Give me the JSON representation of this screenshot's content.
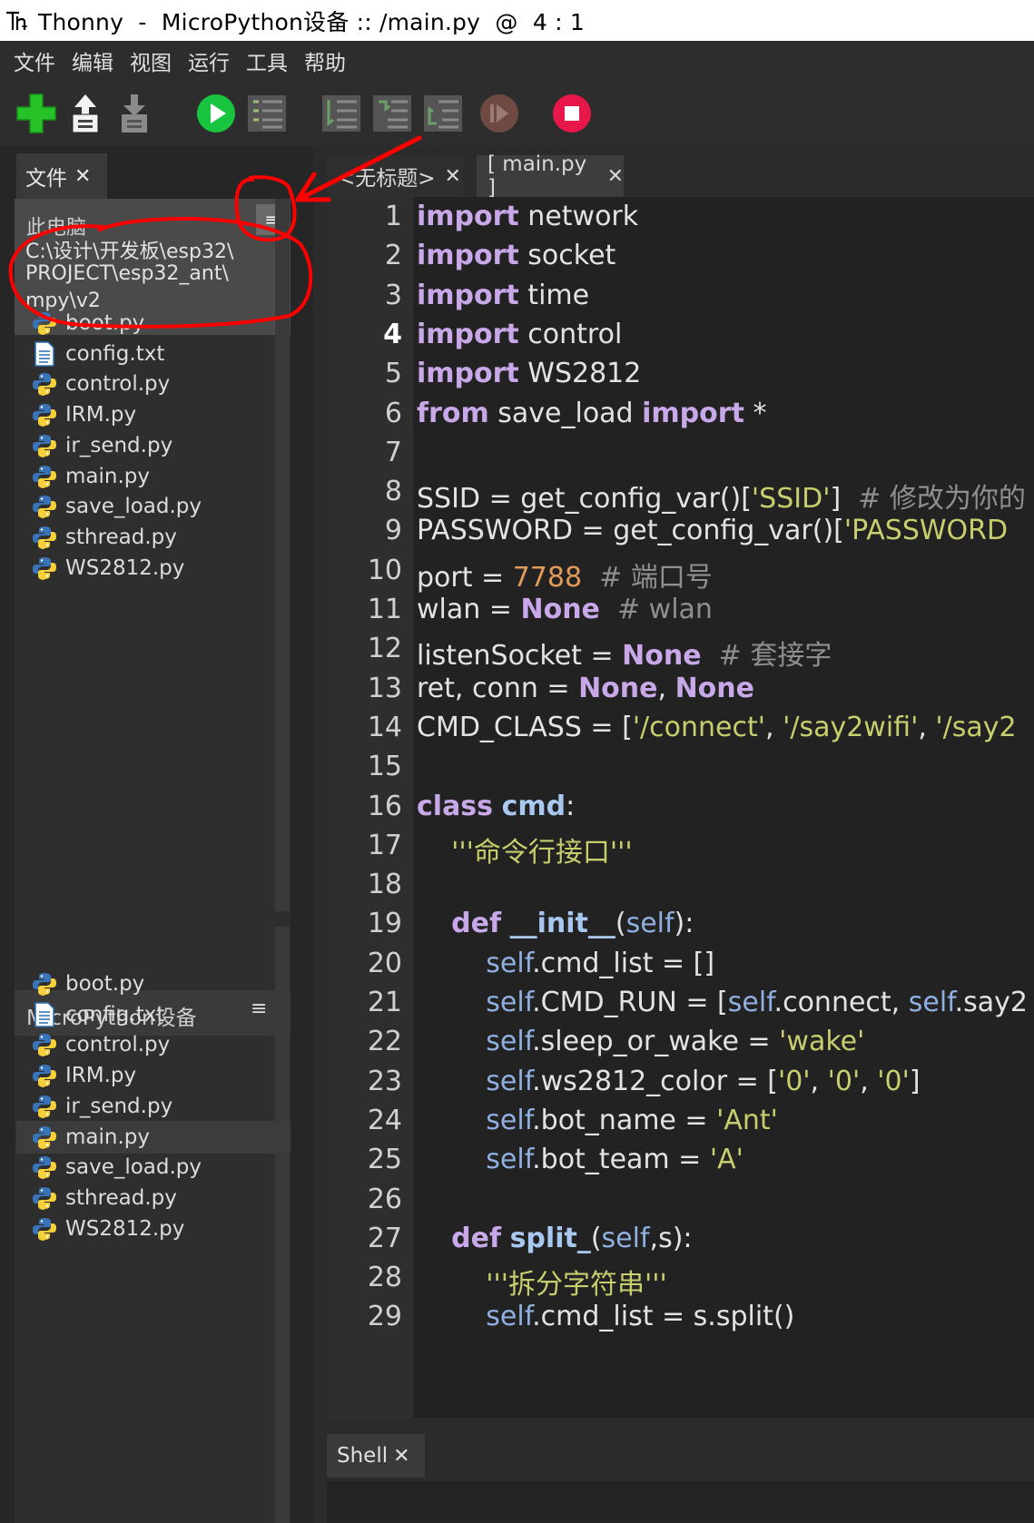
{
  "window": {
    "title": "Thonny  -  MicroPython设备 :: /main.py  @  4 : 1"
  },
  "menu": [
    "文件",
    "编辑",
    "视图",
    "运行",
    "工具",
    "帮助"
  ],
  "toolbar": {
    "icons": [
      "new-file-icon",
      "open-file-icon",
      "save-file-icon",
      "run-icon",
      "debug-icon",
      "step-over-icon",
      "step-into-icon",
      "step-out-icon",
      "resume-icon",
      "stop-icon"
    ]
  },
  "files_pane": {
    "tab_label": "文件",
    "close": "✕",
    "pc_title": "此电脑",
    "path_lines": [
      "C:\\设计\\开发板\\esp32\\",
      "PROJECT\\esp32_ant\\",
      "mpy\\v2"
    ],
    "menu_glyph": "≡",
    "local_files": [
      {
        "name": "boot.py",
        "type": "python"
      },
      {
        "name": "config.txt",
        "type": "text"
      },
      {
        "name": "control.py",
        "type": "python"
      },
      {
        "name": "IRM.py",
        "type": "python"
      },
      {
        "name": "ir_send.py",
        "type": "python"
      },
      {
        "name": "main.py",
        "type": "python"
      },
      {
        "name": "save_load.py",
        "type": "python"
      },
      {
        "name": "sthread.py",
        "type": "python"
      },
      {
        "name": "WS2812.py",
        "type": "python"
      }
    ],
    "device_title": "MicroPython设备",
    "device_files": [
      {
        "name": "boot.py",
        "type": "python"
      },
      {
        "name": "config.txt",
        "type": "text"
      },
      {
        "name": "control.py",
        "type": "python"
      },
      {
        "name": "IRM.py",
        "type": "python"
      },
      {
        "name": "ir_send.py",
        "type": "python"
      },
      {
        "name": "main.py",
        "type": "python",
        "selected": true
      },
      {
        "name": "save_load.py",
        "type": "python"
      },
      {
        "name": "sthread.py",
        "type": "python"
      },
      {
        "name": "WS2812.py",
        "type": "python"
      }
    ]
  },
  "editor": {
    "tabs": [
      {
        "label": "<无标题>",
        "close": "✕",
        "active": false
      },
      {
        "label": "[ main.py ]",
        "close": "✕",
        "active": true
      }
    ],
    "current_line": 4,
    "lines": [
      [
        [
          "kw",
          "import"
        ],
        [
          "t",
          " network"
        ]
      ],
      [
        [
          "kw",
          "import"
        ],
        [
          "t",
          " socket"
        ]
      ],
      [
        [
          "kw",
          "import"
        ],
        [
          "t",
          " time"
        ]
      ],
      [
        [
          "kw",
          "import"
        ],
        [
          "t",
          " control"
        ]
      ],
      [
        [
          "kw",
          "import"
        ],
        [
          "t",
          " WS2812"
        ]
      ],
      [
        [
          "kw",
          "from"
        ],
        [
          "t",
          " save_load "
        ],
        [
          "kw",
          "import"
        ],
        [
          "t",
          " *"
        ]
      ],
      [],
      [
        [
          "t",
          "SSID = get_config_var()["
        ],
        [
          "str",
          "'SSID'"
        ],
        [
          "t",
          "]  "
        ],
        [
          "cmt",
          "# 修改为你的"
        ]
      ],
      [
        [
          "t",
          "PASSWORD = get_config_var()["
        ],
        [
          "str",
          "'PASSWORD"
        ]
      ],
      [
        [
          "t",
          "port = "
        ],
        [
          "num",
          "7788"
        ],
        [
          "t",
          "  "
        ],
        [
          "cmt",
          "# 端口号"
        ]
      ],
      [
        [
          "t",
          "wlan = "
        ],
        [
          "kw",
          "None"
        ],
        [
          "t",
          "  "
        ],
        [
          "cmt",
          "# wlan"
        ]
      ],
      [
        [
          "t",
          "listenSocket = "
        ],
        [
          "kw",
          "None"
        ],
        [
          "t",
          "  "
        ],
        [
          "cmt",
          "# 套接字"
        ]
      ],
      [
        [
          "t",
          "ret, conn = "
        ],
        [
          "kw",
          "None"
        ],
        [
          "t",
          ", "
        ],
        [
          "kw",
          "None"
        ]
      ],
      [
        [
          "t",
          "CMD_CLASS = ["
        ],
        [
          "str",
          "'/connect'"
        ],
        [
          "t",
          ", "
        ],
        [
          "str",
          "'/say2wifi'"
        ],
        [
          "t",
          ", "
        ],
        [
          "str",
          "'/say2"
        ]
      ],
      [],
      [
        [
          "kw",
          "class"
        ],
        [
          "t",
          " "
        ],
        [
          "fn",
          "cmd"
        ],
        [
          "t",
          ":"
        ]
      ],
      [
        [
          "t",
          "    "
        ],
        [
          "str",
          "'''命令行接口'''"
        ]
      ],
      [],
      [
        [
          "t",
          "    "
        ],
        [
          "kw",
          "def"
        ],
        [
          "t",
          " "
        ],
        [
          "fn",
          "__init__"
        ],
        [
          "t",
          "("
        ],
        [
          "self",
          "self"
        ],
        [
          "t",
          "):"
        ]
      ],
      [
        [
          "t",
          "        "
        ],
        [
          "self",
          "self"
        ],
        [
          "t",
          ".cmd_list = []"
        ]
      ],
      [
        [
          "t",
          "        "
        ],
        [
          "self",
          "self"
        ],
        [
          "t",
          ".CMD_RUN = ["
        ],
        [
          "self",
          "self"
        ],
        [
          "t",
          ".connect, "
        ],
        [
          "self",
          "self"
        ],
        [
          "t",
          ".say2"
        ]
      ],
      [
        [
          "t",
          "        "
        ],
        [
          "self",
          "self"
        ],
        [
          "t",
          ".sleep_or_wake = "
        ],
        [
          "str",
          "'wake'"
        ]
      ],
      [
        [
          "t",
          "        "
        ],
        [
          "self",
          "self"
        ],
        [
          "t",
          ".ws2812_color = ["
        ],
        [
          "str",
          "'0'"
        ],
        [
          "t",
          ", "
        ],
        [
          "str",
          "'0'"
        ],
        [
          "t",
          ", "
        ],
        [
          "str",
          "'0'"
        ],
        [
          "t",
          "]"
        ]
      ],
      [
        [
          "t",
          "        "
        ],
        [
          "self",
          "self"
        ],
        [
          "t",
          ".bot_name = "
        ],
        [
          "str",
          "'Ant'"
        ]
      ],
      [
        [
          "t",
          "        "
        ],
        [
          "self",
          "self"
        ],
        [
          "t",
          ".bot_team = "
        ],
        [
          "str",
          "'A'"
        ]
      ],
      [],
      [
        [
          "t",
          "    "
        ],
        [
          "kw",
          "def"
        ],
        [
          "t",
          " "
        ],
        [
          "fn",
          "split_"
        ],
        [
          "t",
          "("
        ],
        [
          "self",
          "self"
        ],
        [
          "t",
          ",s):"
        ]
      ],
      [
        [
          "t",
          "        "
        ],
        [
          "str",
          "'''拆分字符串'''"
        ]
      ],
      [
        [
          "t",
          "        "
        ],
        [
          "self",
          "self"
        ],
        [
          "t",
          ".cmd_list = s.split()"
        ]
      ]
    ]
  },
  "shell": {
    "tab_label": "Shell",
    "close": "✕"
  },
  "colors": {
    "annotation": "#ff0000",
    "keyword": "#c8a8e8",
    "string": "#c8cd6e",
    "number": "#e09a5a",
    "comment": "#8f8f8f"
  }
}
